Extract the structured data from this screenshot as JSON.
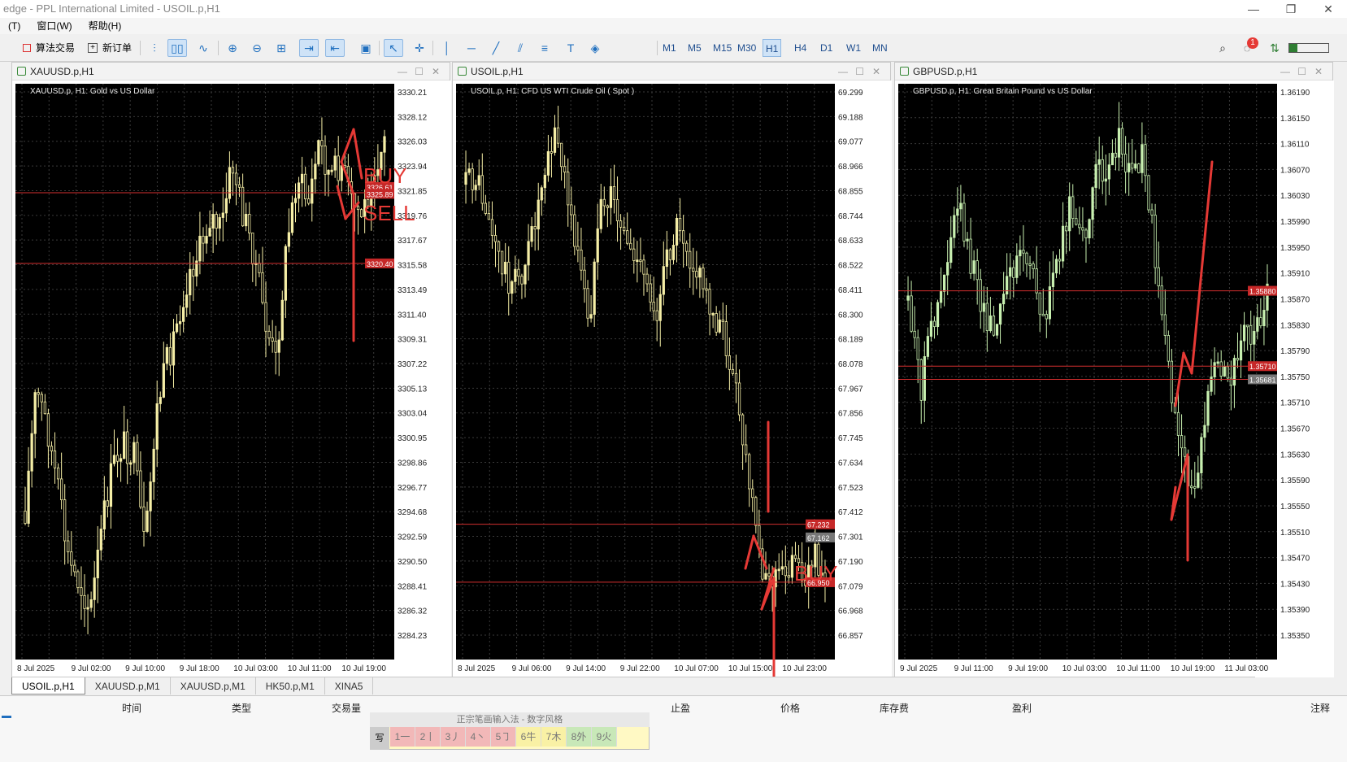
{
  "window": {
    "title": "edge - PPL International Limited - USOIL.p,H1",
    "controls": [
      "—",
      "❐",
      "✕"
    ]
  },
  "menu": {
    "items": [
      "(T)",
      "窗口(W)",
      "帮助(H)"
    ]
  },
  "toolbar": {
    "algo_trading": "算法交易",
    "new_order": "新订单",
    "timeframes": [
      "M1",
      "M5",
      "M15",
      "M30",
      "H1",
      "H4",
      "D1",
      "W1",
      "MN"
    ],
    "active_timeframe": "H1",
    "notification_count": "1"
  },
  "charts": [
    {
      "window_title": "XAUUSD.p,H1",
      "info": "XAUUSD.p, H1:  Gold vs US Dollar",
      "price_labels": [
        "3330.21",
        "3328.12",
        "3326.03",
        "3323.94",
        "3321.85",
        "3319.76",
        "3317.67",
        "3315.58",
        "3313.49",
        "3311.40",
        "3309.31",
        "3307.22",
        "3305.13",
        "3303.04",
        "3300.95",
        "3298.86",
        "3296.77",
        "3294.68",
        "3292.59",
        "3290.50",
        "3288.41",
        "3286.32",
        "3284.23"
      ],
      "time_labels": [
        "8 Jul 2025",
        "9 Jul 02:00",
        "9 Jul 10:00",
        "9 Jul 18:00",
        "10 Jul 03:00",
        "10 Jul 11:00",
        "10 Jul 19:00"
      ],
      "red_tags": [
        "3326.61",
        "3325.89",
        "3320.40"
      ],
      "annotations": [
        "BUY",
        "SELL"
      ],
      "candle_color": "#f5eea6"
    },
    {
      "window_title": "USOIL.p,H1",
      "info": "USOIL.p, H1:  CFD US WTI Crude Oil ( Spot )",
      "price_labels": [
        "69.299",
        "69.188",
        "69.077",
        "68.966",
        "68.855",
        "68.744",
        "68.633",
        "68.522",
        "68.411",
        "68.300",
        "68.189",
        "68.078",
        "67.967",
        "67.856",
        "67.745",
        "67.634",
        "67.523",
        "67.412",
        "67.301",
        "67.190",
        "67.079",
        "66.968",
        "66.857"
      ],
      "time_labels": [
        "8 Jul 2025",
        "9 Jul 06:00",
        "9 Jul 14:00",
        "9 Jul 22:00",
        "10 Jul 07:00",
        "10 Jul 15:00",
        "10 Jul 23:00"
      ],
      "red_tags": [
        "67.232",
        "67.162",
        "66.950"
      ],
      "annotations": [
        "BUY"
      ],
      "candle_color": "#f5eea6"
    },
    {
      "window_title": "GBPUSD.p,H1",
      "info": "GBPUSD.p, H1:  Great Britain Pound vs US Dollar",
      "price_labels": [
        "1.36190",
        "1.36150",
        "1.36110",
        "1.36070",
        "1.36030",
        "1.35990",
        "1.35950",
        "1.35910",
        "1.35870",
        "1.35830",
        "1.35790",
        "1.35750",
        "1.35710",
        "1.35670",
        "1.35630",
        "1.35590",
        "1.35550",
        "1.35510",
        "1.35470",
        "1.35430",
        "1.35390",
        "1.35350"
      ],
      "time_labels": [
        "9 Jul 2025",
        "9 Jul 11:00",
        "9 Jul 19:00",
        "10 Jul 03:00",
        "10 Jul 11:00",
        "10 Jul 19:00",
        "11 Jul 03:00"
      ],
      "red_tags": [
        "1.35880",
        "1.35710",
        "1.35681"
      ],
      "annotations": [],
      "candle_color": "#c8f0b0"
    }
  ],
  "symbol_tabs": [
    "USOIL.p,H1",
    "XAUUSD.p,M1",
    "XAUUSD.p,M1",
    "HK50.p,M1",
    "XINA5"
  ],
  "active_symbol_tab": "USOIL.p,H1",
  "terminal": {
    "columns": [
      "时间",
      "类型",
      "交易量",
      "止盈",
      "价格",
      "库存费",
      "盈利",
      "注释"
    ]
  },
  "ime": {
    "title": "正宗笔画输入法 - 数字风格",
    "candidates": [
      "1一",
      "2丨",
      "3丿",
      "4丶",
      "5㇆",
      "6牛",
      "7木",
      "8外",
      "9火"
    ],
    "logo": "写"
  }
}
